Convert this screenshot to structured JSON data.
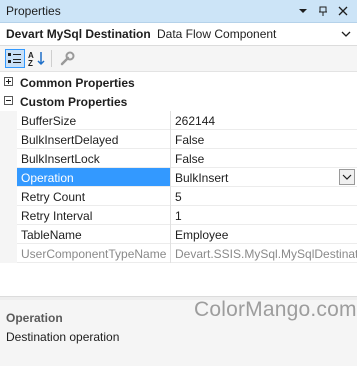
{
  "window": {
    "title": "Properties"
  },
  "object_selector": {
    "name": "Devart MySql Destination",
    "type": "Data Flow Component"
  },
  "categories": [
    {
      "label": "Common Properties",
      "expanded": false
    },
    {
      "label": "Custom Properties",
      "expanded": true
    }
  ],
  "properties": [
    {
      "name": "BufferSize",
      "value": "262144"
    },
    {
      "name": "BulkInsertDelayed",
      "value": "False"
    },
    {
      "name": "BulkInsertLock",
      "value": "False"
    },
    {
      "name": "Operation",
      "value": "BulkInsert"
    },
    {
      "name": "Retry Count",
      "value": "5"
    },
    {
      "name": "Retry Interval",
      "value": "1"
    },
    {
      "name": "TableName",
      "value": "Employee"
    },
    {
      "name": "UserComponentTypeName",
      "value": "Devart.SSIS.MySql.MySqlDestination"
    }
  ],
  "description": {
    "title": "Operation",
    "text": "Destination operation"
  },
  "watermark": "ColorMango.com",
  "colors": {
    "title_bar": "#cce4f7",
    "selection": "#3399ff",
    "readonly_text": "#8a8a8a"
  }
}
